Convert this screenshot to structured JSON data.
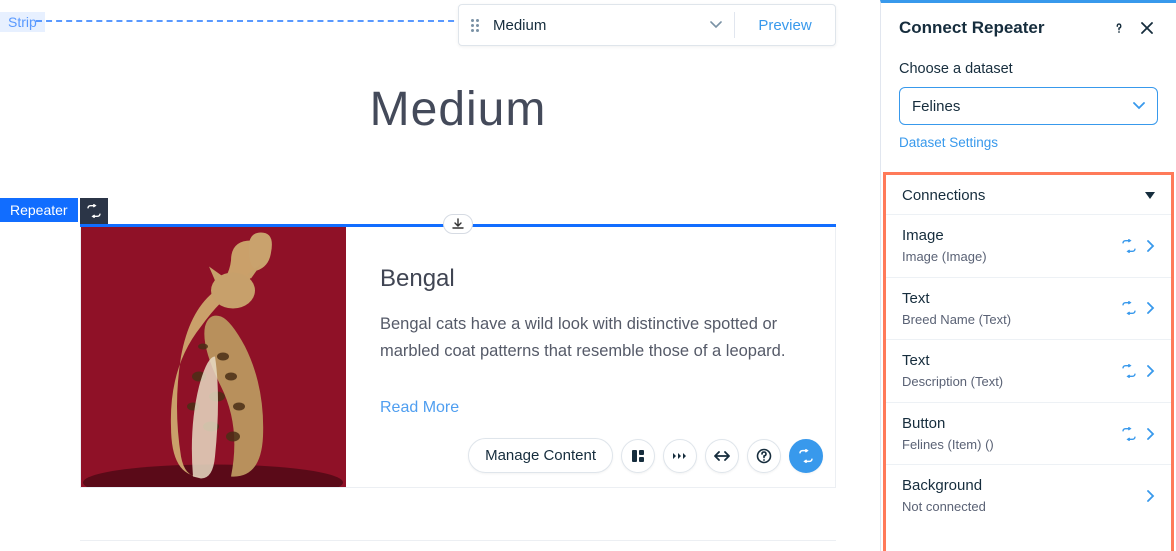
{
  "toolbar": {
    "breakpoint_label": "Medium",
    "preview_label": "Preview"
  },
  "canvas": {
    "strip_label": "Strip",
    "repeater_label": "Repeater",
    "page_title": "Medium",
    "card": {
      "title": "Bengal",
      "description": "Bengal cats have a wild look with distinctive spotted or marbled coat patterns that resemble those of a leopard.",
      "link_label": "Read More"
    },
    "actions": {
      "manage_content_label": "Manage Content"
    }
  },
  "panel": {
    "title": "Connect Repeater",
    "dataset_label": "Choose a dataset",
    "dataset_value": "Felines",
    "dataset_settings_label": "Dataset Settings",
    "connections_header": "Connections",
    "connections": [
      {
        "title": "Image",
        "sub": "Image (Image)",
        "connected": true
      },
      {
        "title": "Text",
        "sub": "Breed Name (Text)",
        "connected": true
      },
      {
        "title": "Text",
        "sub": "Description (Text)",
        "connected": true
      },
      {
        "title": "Button",
        "sub": "Felines (Item) ()",
        "connected": true
      },
      {
        "title": "Background",
        "sub": "Not connected",
        "connected": false
      }
    ]
  }
}
